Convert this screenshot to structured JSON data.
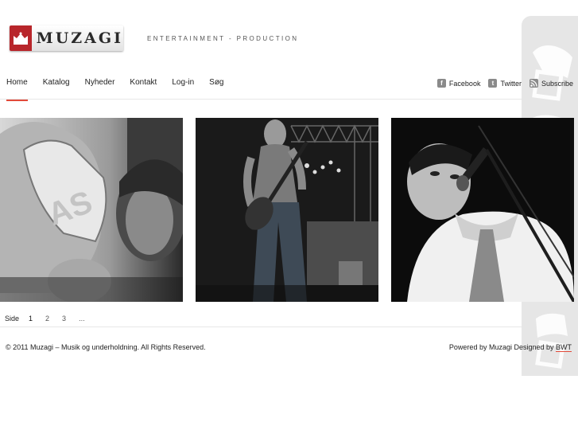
{
  "header": {
    "brand": "MUZAGI",
    "tagline": "ENTERTAINMENT - PRODUCTION"
  },
  "nav": {
    "items": [
      {
        "label": "Home",
        "active": true
      },
      {
        "label": "Katalog"
      },
      {
        "label": "Nyheder"
      },
      {
        "label": "Kontakt"
      },
      {
        "label": "Log-in"
      },
      {
        "label": "Søg"
      }
    ]
  },
  "social": {
    "facebook": {
      "label": "Facebook",
      "icon": "facebook-icon"
    },
    "twitter": {
      "label": "Twitter",
      "icon": "twitter-icon"
    },
    "subscribe": {
      "label": "Subscribe",
      "icon": "rss-icon"
    }
  },
  "gallery": [
    {
      "subject": "hand-holding-guitar-pick"
    },
    {
      "subject": "guitarist-on-stage"
    },
    {
      "subject": "singer-at-microphone"
    }
  ],
  "pagination": {
    "label": "Side",
    "pages": [
      "1",
      "2",
      "3",
      "..."
    ],
    "current": "1"
  },
  "footer": {
    "copyright": "© 2011 Muzagi – Musik og underholdning. All Rights Reserved.",
    "powered_prefix": "Powered by Muzagi Designed by ",
    "powered_link": "BWT"
  },
  "colors": {
    "accent": "#e24a3a",
    "logo_red": "#b8262b"
  }
}
